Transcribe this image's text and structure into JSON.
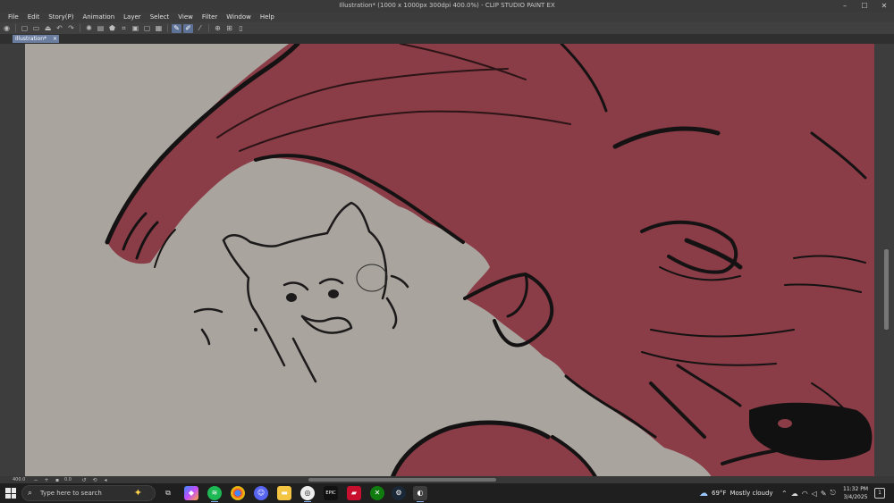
{
  "window": {
    "title": "Illustration* (1000 x 1000px 300dpi 400.0%) - CLIP STUDIO PAINT EX",
    "minimize": "–",
    "maximize": "☐",
    "close": "✕"
  },
  "menu": [
    "File",
    "Edit",
    "Story(P)",
    "Animation",
    "Layer",
    "Select",
    "View",
    "Filter",
    "Window",
    "Help"
  ],
  "toolbar": {
    "icons": [
      "app-menu-icon",
      "new-file-icon",
      "open-file-icon",
      "save-file-icon",
      "undo-icon",
      "redo-icon",
      "loading-icon",
      "fill-icon",
      "transform-icon",
      "clear-icon",
      "fill-selection-icon",
      "cut-icon",
      "pen-active-icon",
      "pen-active-2-icon",
      "line-icon",
      "snap-icon",
      "ruler-icon",
      "device-icon"
    ]
  },
  "document_tab": {
    "label": "Illustration*",
    "close": "×"
  },
  "status": {
    "zoom": "400.0",
    "rotation": "0.0"
  },
  "taskbar": {
    "search_placeholder": "Type here to search",
    "weather_temp": "69°F",
    "weather_text": "Mostly cloudy",
    "time": "11:32 PM",
    "date": "3/4/2025",
    "notification_count": "1"
  },
  "colors": {
    "canvas_bg": "#a9a49e",
    "fur_red": "#8a3c47",
    "line": "#141212",
    "ui_dark": "#2b2b2b",
    "accent": "#5d7296"
  }
}
